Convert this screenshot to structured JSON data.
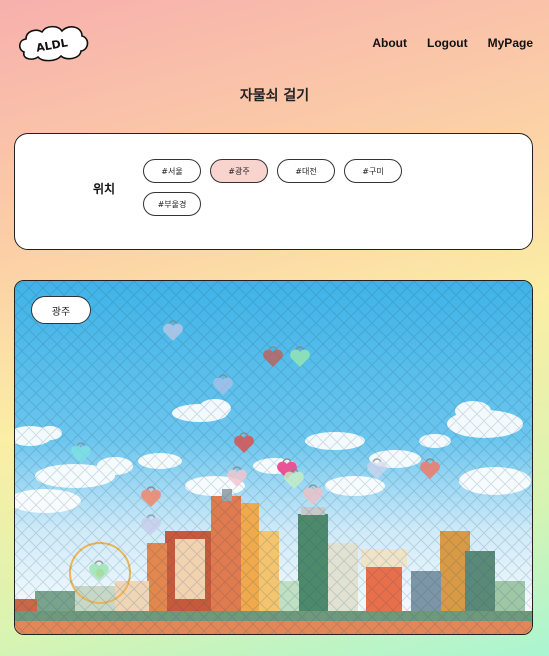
{
  "header": {
    "logo_text": "ALDL",
    "nav": [
      {
        "label": "About"
      },
      {
        "label": "Logout"
      },
      {
        "label": "MyPage"
      }
    ]
  },
  "page_title": "자물쇠 걸기",
  "filter": {
    "label": "위치",
    "chips": [
      {
        "label": "#서울",
        "active": false
      },
      {
        "label": "#광주",
        "active": true
      },
      {
        "label": "#대전",
        "active": false
      },
      {
        "label": "#구미",
        "active": false
      },
      {
        "label": "#부울경",
        "active": false
      }
    ]
  },
  "scene": {
    "region_label": "광주",
    "colors": {
      "sky_top": "#3fb3e7",
      "sky_bottom": "#ffffff"
    },
    "locks": [
      {
        "color": "#b9c9e6",
        "opacity": 0.8
      },
      {
        "color": "#c0605a",
        "opacity": 0.8
      },
      {
        "color": "#8fe3b8",
        "opacity": 0.9
      },
      {
        "color": "#a9c1e8",
        "opacity": 0.8
      },
      {
        "color": "#d9534f",
        "opacity": 0.85
      },
      {
        "color": "#7fe6e0",
        "opacity": 0.7
      },
      {
        "color": "#e8428b",
        "opacity": 0.9
      },
      {
        "color": "#c7f0c4",
        "opacity": 0.8
      },
      {
        "color": "#f5c6cf",
        "opacity": 0.8
      },
      {
        "color": "#f08a72",
        "opacity": 0.9
      },
      {
        "color": "#d5d5ef",
        "opacity": 0.7
      },
      {
        "color": "#e98070",
        "opacity": 0.9
      },
      {
        "color": "#f0c0c5",
        "opacity": 0.8
      },
      {
        "color": "#c9c9e9",
        "opacity": 0.7
      },
      {
        "color": "#9be6b0",
        "opacity": 0.8
      }
    ]
  }
}
